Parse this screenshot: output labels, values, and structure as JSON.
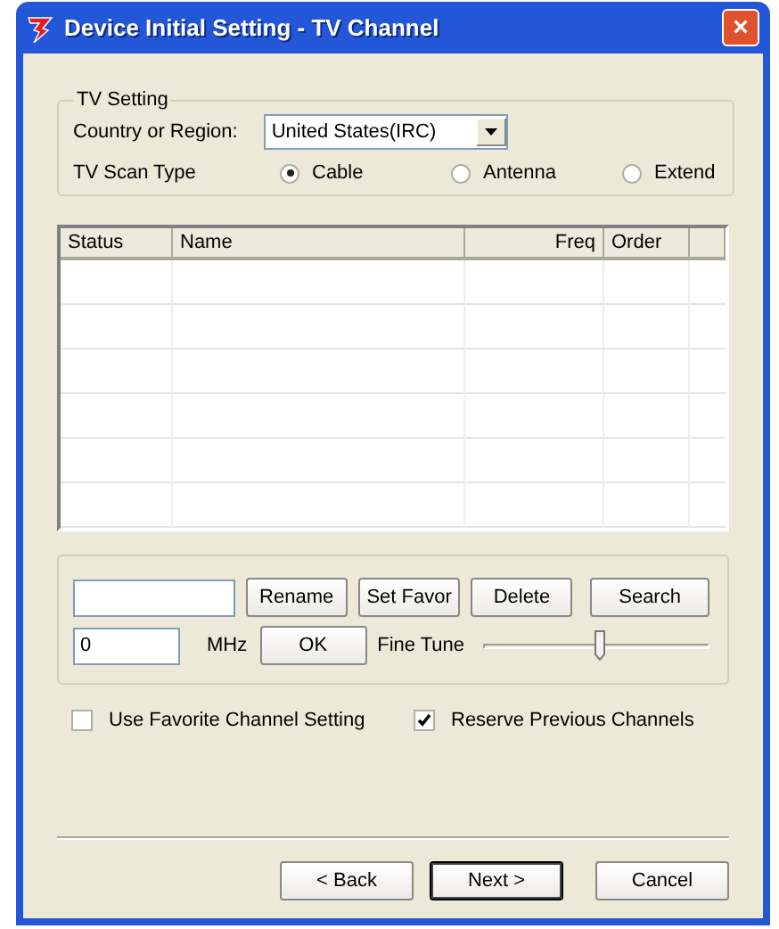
{
  "window": {
    "title": "Device Initial Setting - TV Channel",
    "close": "×"
  },
  "tv_setting": {
    "legend": "TV Setting",
    "country_label": "Country or Region:",
    "country_value": "United States(IRC)",
    "scan_label": "TV Scan Type",
    "scan_options": [
      {
        "label": "Cable",
        "selected": true
      },
      {
        "label": "Antenna",
        "selected": false
      },
      {
        "label": "Extend",
        "selected": false
      }
    ]
  },
  "table": {
    "columns": [
      {
        "label": "Status"
      },
      {
        "label": "Name"
      },
      {
        "label": "Freq"
      },
      {
        "label": "Order"
      }
    ]
  },
  "edit_panel": {
    "buttons": [
      "Rename",
      "Set Favor",
      "Delete",
      "Search"
    ],
    "freq_value": "0",
    "unit": "MHz",
    "ok": "OK",
    "fine_tune_label": "Fine Tune",
    "fine_tune": {
      "level": 0.51
    }
  },
  "options": [
    {
      "label": "Use Favorite Channel Setting",
      "checked": false
    },
    {
      "label": "Reserve Previous Channels",
      "checked": true
    }
  ],
  "buttons": [
    {
      "label": "< Back",
      "default": false
    },
    {
      "label": "Next >",
      "default": true
    },
    {
      "label": "Cancel",
      "default": false
    }
  ]
}
